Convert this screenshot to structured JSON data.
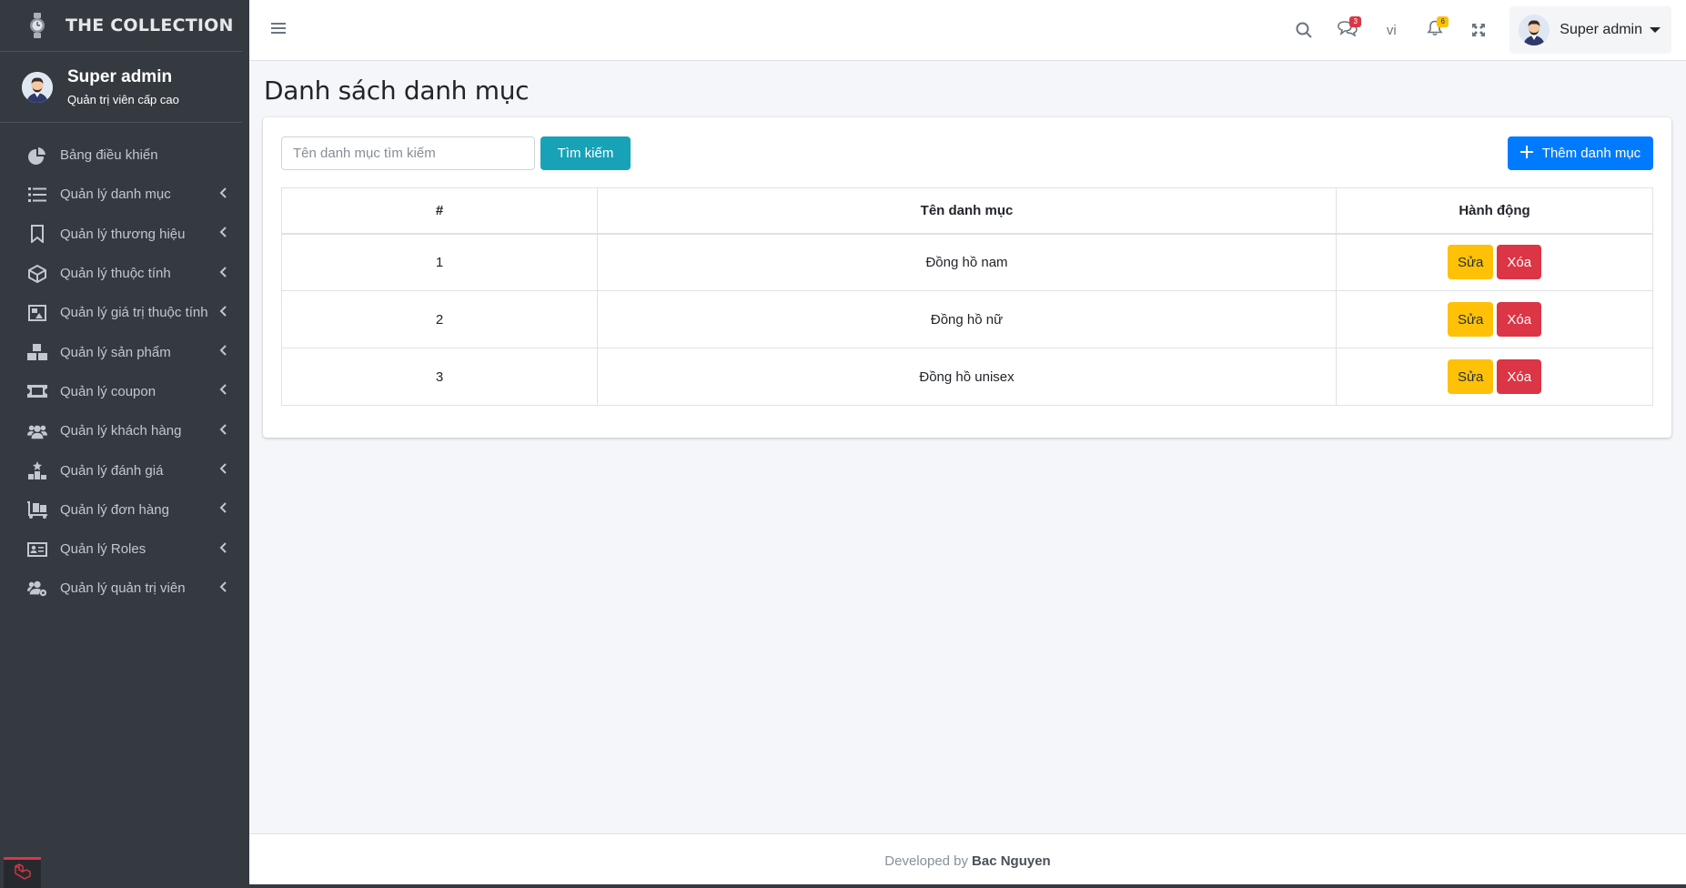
{
  "brand": {
    "name": "THE COLLECTION",
    "logo_icon": "watch-icon"
  },
  "user_panel": {
    "name": "Super admin",
    "role": "Quản trị viên cấp cao"
  },
  "sidebar": {
    "items": [
      {
        "label": "Bảng điều khiển",
        "icon": "chart-pie-icon",
        "has_children": false
      },
      {
        "label": "Quản lý danh mục",
        "icon": "list-icon",
        "has_children": true
      },
      {
        "label": "Quản lý thương hiệu",
        "icon": "bookmark-icon",
        "has_children": true
      },
      {
        "label": "Quản lý thuộc tính",
        "icon": "cube-icon",
        "has_children": true
      },
      {
        "label": "Quản lý giá trị thuộc tính",
        "icon": "photo-video-icon",
        "has_children": true
      },
      {
        "label": "Quản lý sản phẩm",
        "icon": "boxes-icon",
        "has_children": true
      },
      {
        "label": "Quản lý coupon",
        "icon": "ticket-icon",
        "has_children": true
      },
      {
        "label": "Quản lý khách hàng",
        "icon": "users-icon",
        "has_children": true
      },
      {
        "label": "Quản lý đánh giá",
        "icon": "star-chart-icon",
        "has_children": true
      },
      {
        "label": "Quản lý đơn hàng",
        "icon": "dolly-icon",
        "has_children": true
      },
      {
        "label": "Quản lý Roles",
        "icon": "id-card-icon",
        "has_children": true
      },
      {
        "label": "Quản lý quản trị viên",
        "icon": "users-cog-icon",
        "has_children": true
      }
    ]
  },
  "topbar": {
    "messages_badge": "3",
    "language": "vi",
    "notifications_badge": "6",
    "user_name": "Super admin"
  },
  "page": {
    "title": "Danh sách danh mục",
    "search_placeholder": "Tên danh mục tìm kiếm",
    "search_button": "Tìm kiếm",
    "add_button": "Thêm danh mục"
  },
  "table": {
    "headers": [
      "#",
      "Tên danh mục",
      "Hành động"
    ],
    "rows": [
      {
        "index": "1",
        "name": "Đồng hồ nam"
      },
      {
        "index": "2",
        "name": "Đồng hồ nữ"
      },
      {
        "index": "3",
        "name": "Đồng hồ unisex"
      }
    ],
    "edit_label": "Sửa",
    "delete_label": "Xóa"
  },
  "footer": {
    "prefix": "Developed by",
    "author": "Bac Nguyen"
  },
  "colors": {
    "sidebar_bg": "#343a40",
    "primary": "#007bff",
    "info": "#17a2b8",
    "warning": "#ffc107",
    "danger": "#dc3545"
  }
}
